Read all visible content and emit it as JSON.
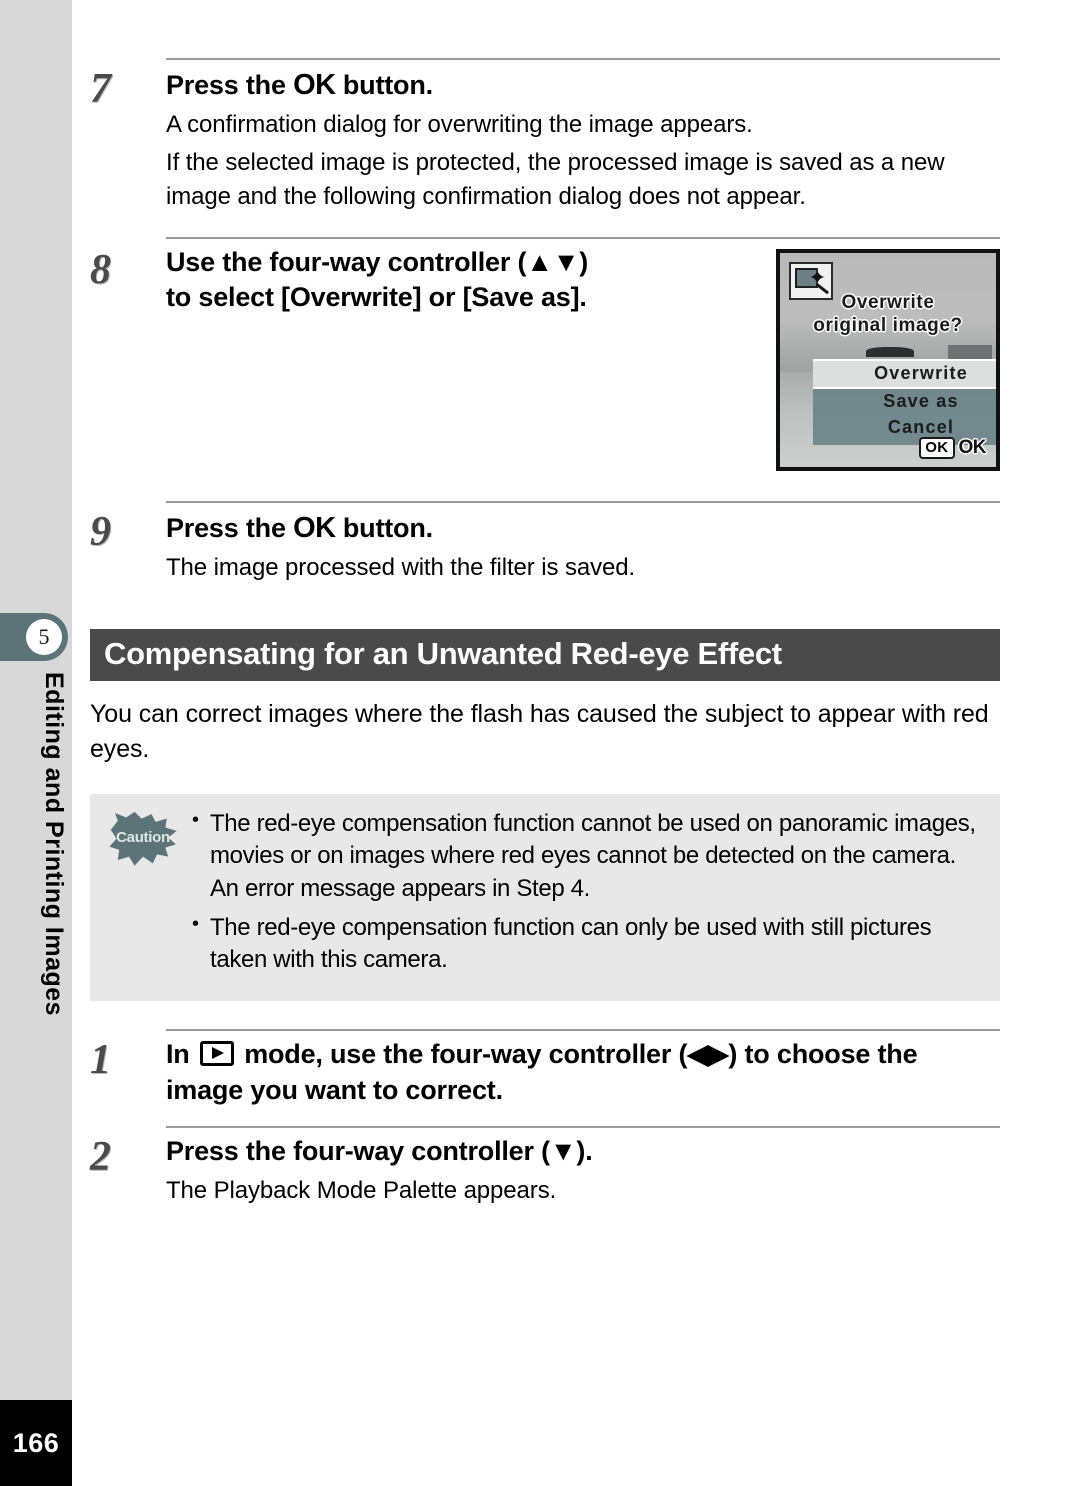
{
  "page": {
    "number": "166",
    "chapter_tab": "5",
    "running_head": "Editing and Printing Images"
  },
  "steps_top": [
    {
      "number": "7",
      "heading_pre": "Press the ",
      "heading_ok": "OK",
      "heading_post": " button.",
      "body_lines": [
        "A confirmation dialog for overwriting the image appears.",
        "If the selected image is protected, the processed image is saved as a new image and the following confirmation dialog does not appear."
      ]
    },
    {
      "number": "8",
      "heading_line1": "Use the four-way controller (▲▼)",
      "heading_line2": "to select [Overwrite] or [Save as]."
    },
    {
      "number": "9",
      "heading_pre": "Press the ",
      "heading_ok": "OK",
      "heading_post": " button.",
      "body_lines": [
        "The image processed with the filter is saved."
      ]
    }
  ],
  "lcd": {
    "filter_icon": "image-filter-wand-icon",
    "prompt_line1": "Overwrite",
    "prompt_line2": "original image?",
    "menu": [
      {
        "label": "Overwrite",
        "selected": true
      },
      {
        "label": "Save as",
        "selected": false
      },
      {
        "label": "Cancel",
        "selected": false
      }
    ],
    "ok_badge": "OK",
    "ok_label": "OK"
  },
  "section": {
    "heading": "Compensating for an Unwanted Red-eye Effect",
    "intro": "You can correct images where the flash has caused the subject to appear with red eyes."
  },
  "caution": {
    "badge_label": "Caution",
    "items": [
      "The red-eye compensation function cannot be used on panoramic images, movies or on images where red eyes cannot be detected on the camera. An error message appears in Step 4.",
      "The red-eye compensation function can only be used with still pictures taken with this camera."
    ]
  },
  "steps_bottom": [
    {
      "number": "1",
      "heading_pre": "In ",
      "heading_icon": "playback-mode-icon",
      "heading_post": " mode, use the four-way controller (◀▶) to choose the image you want to correct."
    },
    {
      "number": "2",
      "heading": "Press the four-way controller (▼).",
      "body_lines": [
        "The Playback Mode Palette appears."
      ]
    }
  ]
}
